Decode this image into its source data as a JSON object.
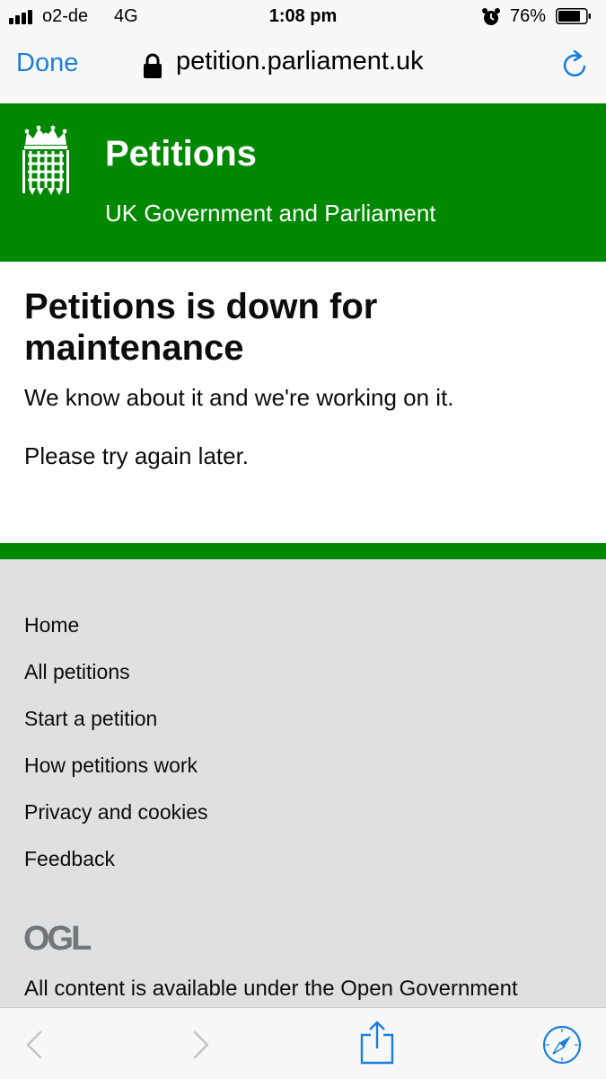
{
  "status_bar": {
    "carrier": "o2-de",
    "network": "4G",
    "time": "1:08 pm",
    "battery_percent": "76%",
    "icons": [
      "signal-icon",
      "alarm-icon",
      "battery-icon"
    ]
  },
  "browser": {
    "done_label": "Done",
    "url": "petition.parliament.uk",
    "icons": [
      "lock-icon",
      "reload-icon"
    ]
  },
  "header": {
    "title": "Petitions",
    "subtitle": "UK Government and Parliament",
    "icons": [
      "portcullis-crest-icon"
    ]
  },
  "main": {
    "heading": "Petitions is down for maintenance",
    "paragraph_1": "We know about it and we're working on it.",
    "paragraph_2": "Please try again later."
  },
  "footer": {
    "links": [
      {
        "label": "Home"
      },
      {
        "label": "All petitions"
      },
      {
        "label": "Start a petition"
      },
      {
        "label": "How petitions work"
      },
      {
        "label": "Privacy and cookies"
      },
      {
        "label": "Feedback"
      }
    ],
    "logo_text": "OGL",
    "license_text": "All content is available under the Open Government"
  },
  "toolbar": {
    "icons": [
      "back-icon",
      "forward-icon",
      "share-icon",
      "compass-icon"
    ]
  },
  "colors": {
    "brand_green": "#008800",
    "link_blue": "#1a7fdc",
    "footer_grey": "#dee0e2",
    "text": "#0b0c0c"
  }
}
